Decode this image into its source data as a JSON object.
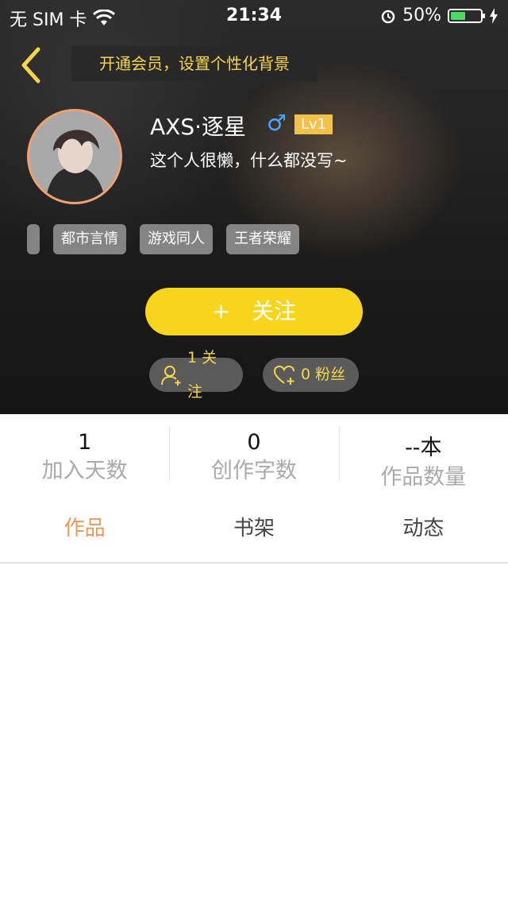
{
  "status_bar": {
    "carrier": "无 SIM 卡",
    "time": "21:34",
    "battery_percent": "50%",
    "battery_color": "#4cd964"
  },
  "nav": {
    "back_icon": "chevron-left-icon",
    "vip_banner": "开通会员，设置个性化背景"
  },
  "profile": {
    "username": "AXS·逐星",
    "gender_symbol": "♂",
    "level": "Lv1",
    "bio": "这个人很懒，什么都没写~",
    "tags": [
      "",
      "都市言情",
      "游戏同人",
      "王者荣耀"
    ]
  },
  "actions": {
    "follow_button": "+   关注",
    "following_count": "1 关注",
    "fans_count": "0 粉丝"
  },
  "stats": [
    {
      "value": "1",
      "label": "加入天数"
    },
    {
      "value": "0",
      "label": "创作字数"
    },
    {
      "value": "--本",
      "label": "作品数量"
    }
  ],
  "tabs": [
    {
      "label": "作品",
      "active": true
    },
    {
      "label": "书架",
      "active": false
    },
    {
      "label": "动态",
      "active": false
    }
  ],
  "colors": {
    "accent_yellow": "#f7d51c",
    "tab_active": "#f0965a",
    "level_badge": "#f1c14a",
    "gender_blue": "#4aa6ff"
  }
}
